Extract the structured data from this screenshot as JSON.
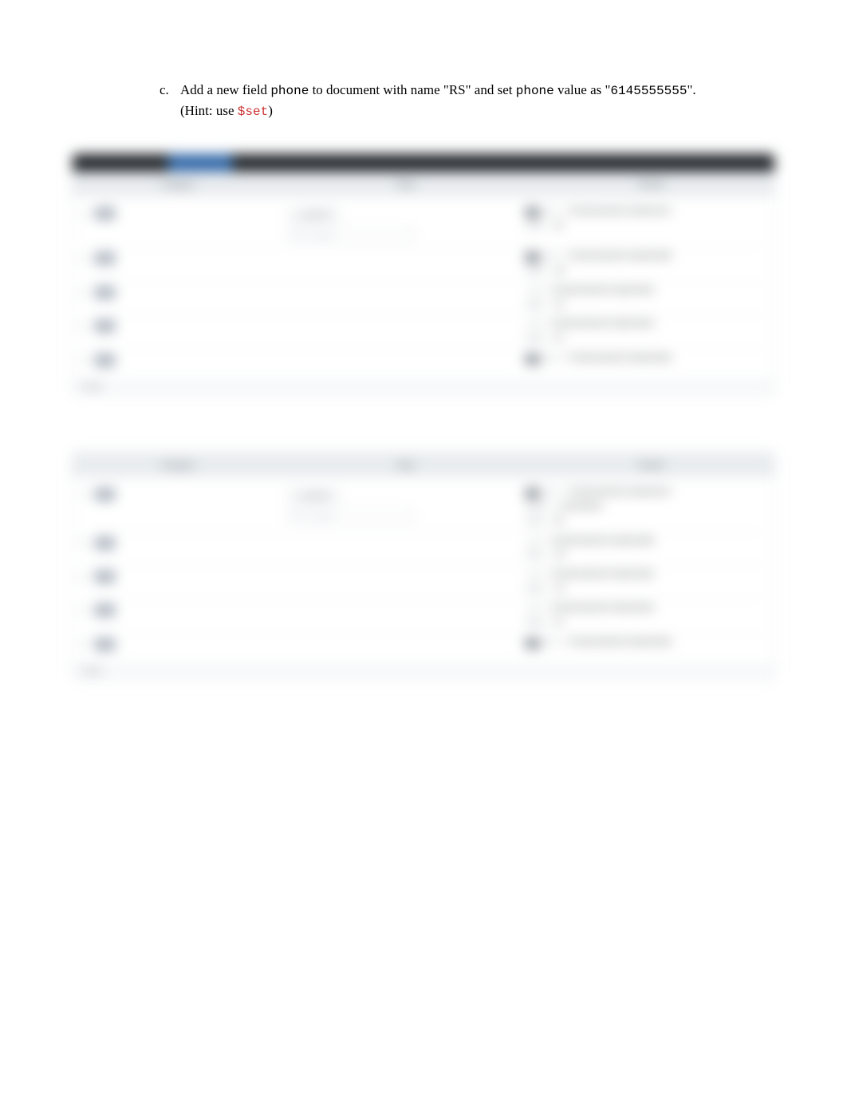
{
  "question": {
    "letter": "c.",
    "text_parts": {
      "p1": "Add a new field ",
      "code1": "phone",
      "p2": " to document with name \"RS\" and set ",
      "code2": "phone",
      "p3": " value as \"",
      "code3": "6145555555",
      "p4": "\". (Hint: use ",
      "red1": "$set",
      "p5": ")"
    }
  },
  "panel1": {
    "headers": {
      "c1": "Category",
      "c2": "Data",
      "c3": "Result"
    },
    "footer": "Ready"
  },
  "panel2": {
    "headers": {
      "c1": "Category",
      "c2": "Data",
      "c3": "Result"
    },
    "footer": "Ready"
  }
}
